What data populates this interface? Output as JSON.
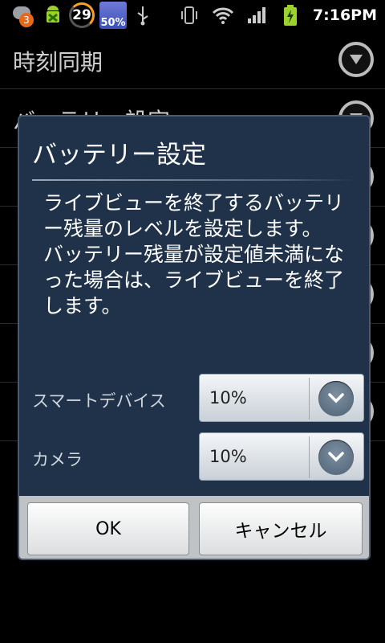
{
  "status_bar": {
    "notification_count": "3",
    "ring_value": "29",
    "weather_text": "50%",
    "time": "7:16PM",
    "icons": [
      "cloud-icon",
      "android-icon",
      "ring-icon",
      "weather-icon",
      "usb-icon",
      "vibrate-icon",
      "wifi-icon",
      "signal-icon",
      "battery-charging-icon"
    ],
    "colors": {
      "ring_accent": "#ff9f1a",
      "badge": "#e8681a",
      "battery": "#9bd22b"
    }
  },
  "background_list": {
    "items": [
      {
        "label": "時刻同期"
      },
      {
        "label": "バッテリー設定"
      },
      {
        "label": ""
      },
      {
        "label": ""
      },
      {
        "label": ""
      },
      {
        "label": ""
      },
      {
        "label": ""
      }
    ]
  },
  "dialog": {
    "title": "バッテリー設定",
    "message": "ライブビューを終了するバッテリー残量のレベルを設定します。\nバッテリー残量が設定値未満になった場合は、ライブビューを終了します。",
    "rows": [
      {
        "label": "スマートデバイス",
        "value": "10%"
      },
      {
        "label": "カメラ",
        "value": "10%"
      }
    ],
    "buttons": {
      "ok": "OK",
      "cancel": "キャンセル"
    },
    "colors": {
      "background": "#1f3249",
      "spinner_button": "#5b6f83"
    }
  }
}
